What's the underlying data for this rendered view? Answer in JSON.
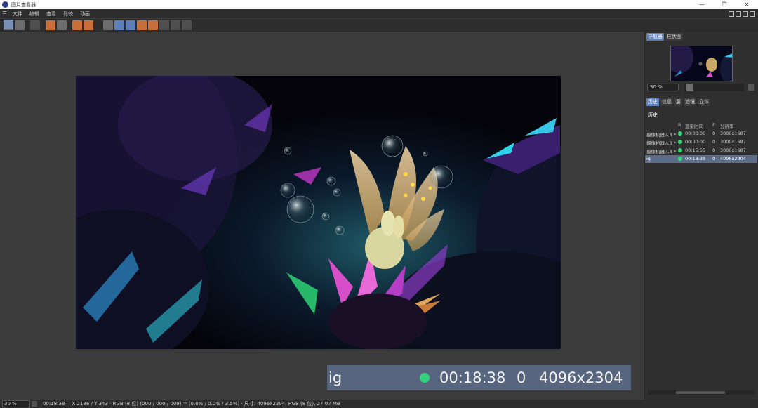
{
  "window": {
    "title": "图片查看器",
    "controls": [
      "—",
      "❐",
      "✕"
    ]
  },
  "menu": {
    "items": [
      "文件",
      "编辑",
      "查看",
      "比较",
      "动画"
    ]
  },
  "panel": {
    "top_tabs": [
      "导航器",
      "柱状图"
    ],
    "zoom_value": "30 %",
    "lower_tabs": [
      "历史",
      "信息",
      "层",
      "滤镜",
      "立体"
    ],
    "history_title": "历史",
    "columns": {
      "r": "R",
      "time": "渲染时间",
      "f": "F",
      "res": "分辨率"
    },
    "rows": [
      {
        "name": "摄像机器人3 *",
        "time": "00:00:00",
        "f": "0",
        "res": "3000x1687"
      },
      {
        "name": "摄像机器人3 *",
        "time": "00:00:00",
        "f": "0",
        "res": "3000x1687"
      },
      {
        "name": "摄像机器人3 *",
        "time": "00:15:55",
        "f": "0",
        "res": "3000x1687"
      },
      {
        "name": "ig",
        "time": "00:18:38",
        "f": "0",
        "res": "4096x2304"
      }
    ]
  },
  "zoom_callout": {
    "name": "ig",
    "time": "00:18:38",
    "f": "0",
    "res": "4096x2304"
  },
  "status": {
    "zoom": "30 %",
    "time": "00:18:38",
    "info": "X 2186 / Y 343 · RGB (8 位) (000 / 000 / 009) = (0.0% / 0.0% / 3.5%) · 尺寸: 4096x2304, RGB (8 位), 27.07 MB"
  },
  "colors": {
    "accent": "#5d7fb8",
    "status_dot": "#34d07d"
  }
}
